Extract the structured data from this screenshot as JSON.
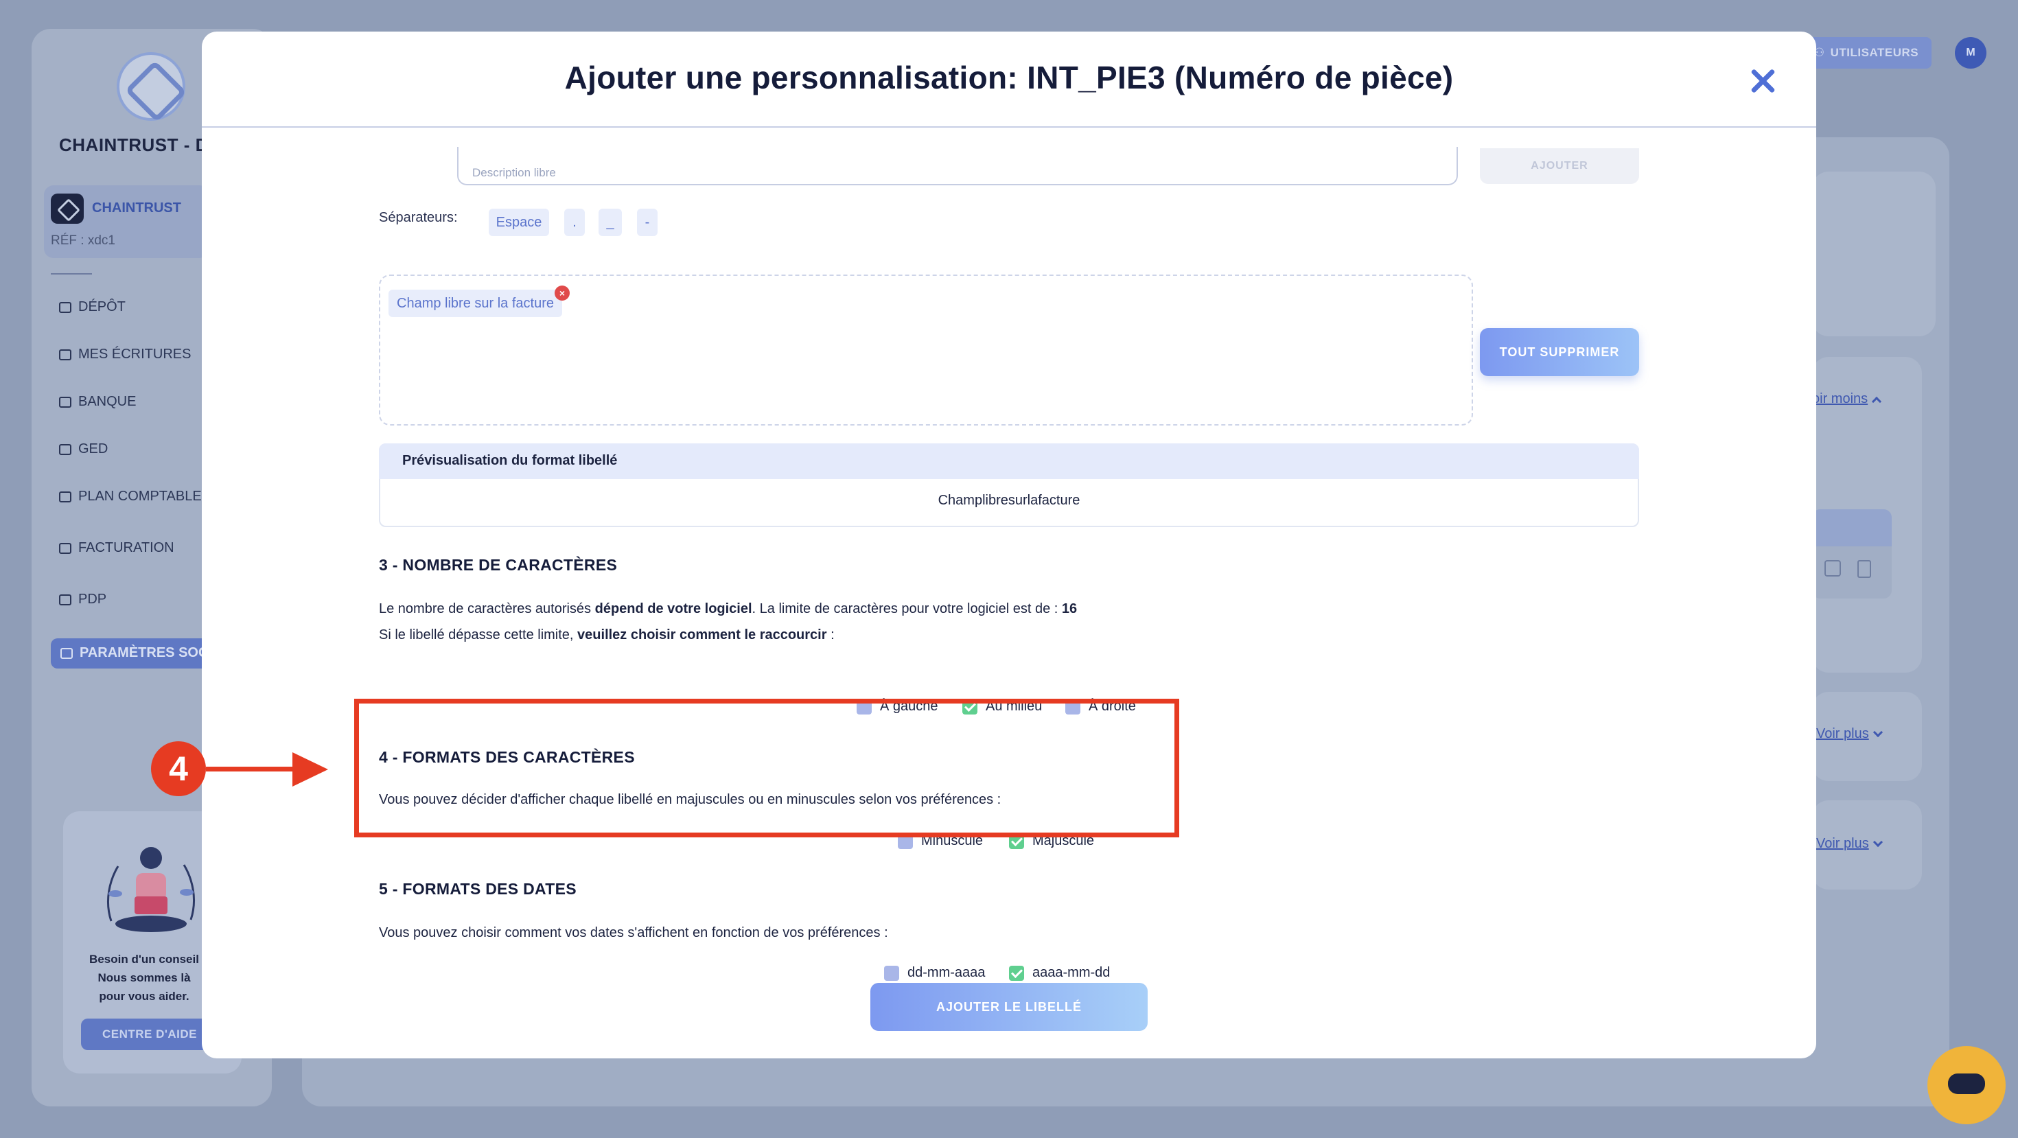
{
  "app": {
    "company_name": "CHAINTRUST - D",
    "client": {
      "name": "CHAINTRUST",
      "ref": "RÉF : xdc1"
    },
    "nav": [
      {
        "label": "DÉPÔT",
        "icon": "upload-icon"
      },
      {
        "label": "MES ÉCRITURES",
        "icon": "folder-icon"
      },
      {
        "label": "BANQUE",
        "icon": "bank-icon"
      },
      {
        "label": "GED",
        "icon": "document-icon"
      },
      {
        "label": "PLAN COMPTABLE",
        "icon": "book-icon"
      },
      {
        "label": "FACTURATION",
        "icon": "invoice-icon"
      },
      {
        "label": "PDP",
        "icon": "card-icon"
      }
    ],
    "nav_active": "PARAMÈTRES SOC",
    "help": {
      "line1": "Besoin d'un conseil",
      "line2": "Nous sommes là",
      "line3": "pour vous aider.",
      "button": "CENTRE D'AIDE"
    },
    "top_right": {
      "users_button": "UTILISATEURS",
      "avatar_initial": "M"
    },
    "links": {
      "voir_moins": "oir moins",
      "voir_plus_1": "Voir plus",
      "voir_plus_2": "Voir plus"
    }
  },
  "modal": {
    "title": "Ajouter une personnalisation: INT_PIE3 (Numéro de pièce)",
    "description": {
      "placeholder": "Description libre",
      "add_button": "AJOUTER"
    },
    "separators": {
      "label": "Séparateurs:",
      "options": [
        "Espace",
        ".",
        "_",
        "-"
      ]
    },
    "tags": [
      "Champ libre sur la facture"
    ],
    "clear_button": "TOUT SUPPRIMER",
    "preview": {
      "header": "Prévisualisation du format libellé",
      "value": "Champlibresurlafacture"
    },
    "section3": {
      "title": "3 - NOMBRE DE CARACTÈRES",
      "line1_pre": "Le nombre de caractères autorisés ",
      "line1_bold": "dépend de votre logiciel",
      "line1_mid": ". La limite de caractères pour votre logiciel est de : ",
      "line1_limit": "16",
      "line2_pre": "Si le libellé dépasse cette limite, ",
      "line2_bold": "veuillez choisir comment le raccourcir",
      "line2_post": " :",
      "options": [
        {
          "label": "À gauche",
          "checked": false
        },
        {
          "label": "Au milieu",
          "checked": true
        },
        {
          "label": "À droite",
          "checked": false
        }
      ]
    },
    "section4": {
      "title": "4 - FORMATS DES CARACTÈRES",
      "text": "Vous pouvez décider d'afficher chaque libellé en majuscules ou en minuscules selon vos préférences :",
      "options": [
        {
          "label": "Minuscule",
          "checked": false
        },
        {
          "label": "Majuscule",
          "checked": true
        }
      ]
    },
    "section5": {
      "title": "5 - FORMATS DES DATES",
      "text": "Vous pouvez choisir comment vos dates s'affichent en fonction de vos préférences :",
      "options": [
        {
          "label": "dd-mm-aaaa",
          "checked": false
        },
        {
          "label": "aaaa-mm-dd",
          "checked": true
        }
      ]
    },
    "submit_button": "AJOUTER LE LIBELLÉ"
  },
  "annotation": {
    "step_number": "4",
    "color": "#e63b22"
  },
  "colors": {
    "accent": "#4f6fd6",
    "checked": "#5fcf8f",
    "unchecked": "#a9b6e8",
    "chat": "#f0b43a"
  }
}
